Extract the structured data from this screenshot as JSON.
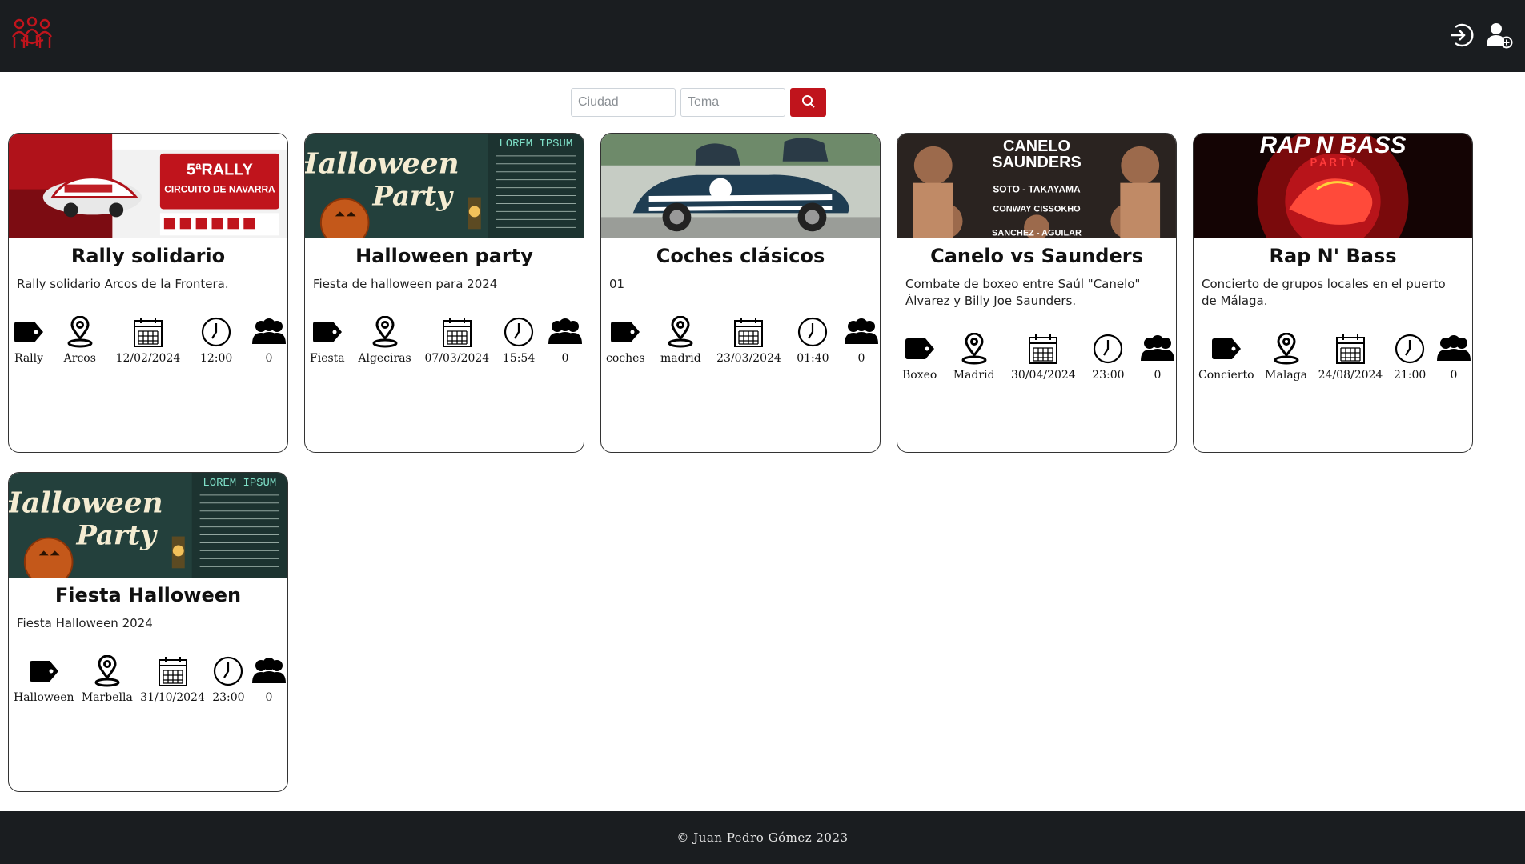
{
  "header": {
    "logo_icon": "people-group-logo-icon",
    "login_icon": "login-icon",
    "register_icon": "add-user-icon",
    "accent": "#c0141c",
    "background": "#1a1d20"
  },
  "search": {
    "city_placeholder": "Ciudad",
    "topic_placeholder": "Tema",
    "button_icon": "search-icon"
  },
  "events": [
    {
      "title": "Rally solidario",
      "description": "Rally solidario Arcos de la Frontera.",
      "image_text": [
        "5ªRALLY",
        "CIRCUITO DE NAVARRA"
      ],
      "category": "Rally",
      "city": "Arcos",
      "date": "12/02/2024",
      "time": "12:00",
      "attendees": "0"
    },
    {
      "title": "Halloween party",
      "description": "Fiesta de halloween para 2024",
      "image_text": [
        "Halloween",
        "Party",
        "LOREM IPSUM"
      ],
      "category": "Fiesta",
      "city": "Algeciras",
      "date": "07/03/2024",
      "time": "15:54",
      "attendees": "0"
    },
    {
      "title": "Coches clásicos",
      "description": "01",
      "image_text": [],
      "category": "coches",
      "city": "madrid",
      "date": "23/03/2024",
      "time": "01:40",
      "attendees": "0"
    },
    {
      "title": "Canelo vs Saunders",
      "description": "Combate de boxeo entre Saúl \"Canelo\" Álvarez y Billy Joe Saunders.",
      "image_text": [
        "CANELO",
        "SAUNDERS",
        "SOTO - TAKAYAMA",
        "CONWAY CISSOKHO",
        "SANCHEZ - AGUILAR"
      ],
      "category": "Boxeo",
      "city": "Madrid",
      "date": "30/04/2024",
      "time": "23:00",
      "attendees": "0"
    },
    {
      "title": "Rap N' Bass",
      "description": "Concierto de grupos locales en el puerto de Málaga.",
      "image_text": [
        "RAP N BASS",
        "P A R T Y"
      ],
      "category": "Concierto",
      "city": "Malaga",
      "date": "24/08/2024",
      "time": "21:00",
      "attendees": "0"
    },
    {
      "title": "Fiesta Halloween",
      "description": "Fiesta Halloween 2024",
      "image_text": [
        "Halloween",
        "Party",
        "LOREM IPSUM"
      ],
      "category": "Halloween",
      "city": "Marbella",
      "date": "31/10/2024",
      "time": "23:00",
      "attendees": "0"
    }
  ],
  "footer": {
    "copyright": "© Juan Pedro Gómez 2023"
  }
}
